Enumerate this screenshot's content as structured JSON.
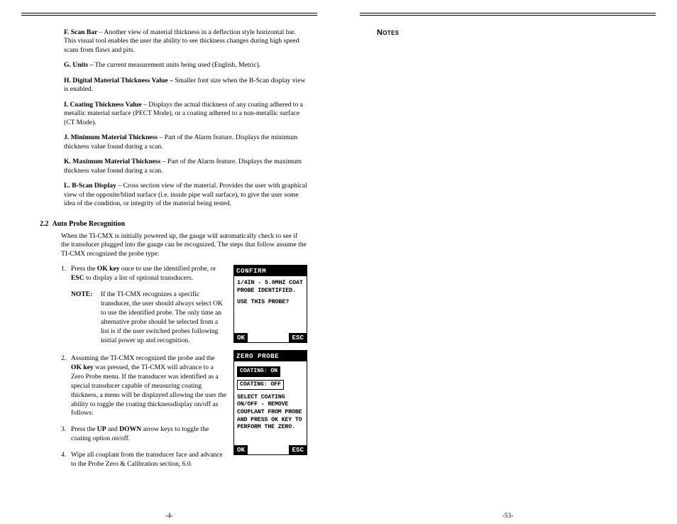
{
  "left": {
    "pageNum": "-4-",
    "defs": [
      {
        "lead": "F.  Scan Bar",
        "sep": " – ",
        "body": "Another view of material thickness in a deflection style horizontal bar. This visual tool enables the user the ability to see thickness changes during high speed scans from flaws and pits."
      },
      {
        "lead": "G. Units –",
        "sep": " ",
        "body": "The current measurement units being used (English, Metric)."
      },
      {
        "lead": "H. Digital Material Thickness Value –",
        "sep": " ",
        "body": "Smaller font size when the B-Scan display view is enabled."
      },
      {
        "lead": "I.  Coating Thickness Value",
        "sep": " – ",
        "body": "Displays the actual thickness of any coating adhered to a metallic material surface (PECT Mode), or a coating adhered to a non-metallic surface (CT Mode)."
      },
      {
        "lead": "J.  Minimum Material Thickness",
        "sep": " – ",
        "body": "Part of the Alarm feature. Displays the minimum thickness value found during a scan."
      },
      {
        "lead": "K. Maximum Material Thickness",
        "sep": " – ",
        "body": "Part of the Alarm feature. Displays the maximum thickness value found during a scan."
      },
      {
        "lead": "L. B-Scan Display",
        "sep": " – ",
        "body": "Cross section view of the material. Provides the user with graphical view of the opposite/blind surface (i.e. inside pipe wall surface), to give the user some idea of the condition, or integrity of the material being tested."
      }
    ],
    "section": {
      "num": "2.2",
      "title": "Auto Probe Recognition",
      "intro": "When the TI-CMX is initially powered up, the gauge will automatically check to see if the transducer plugged into the gauge can be recognized. The steps that follow assume the TI-CMX recognized the probe type:"
    },
    "steps": {
      "s1a": "Press the ",
      "s1key1": "OK key",
      "s1b": " once to use the identified probe, or ",
      "s1key2": "ESC",
      "s1c": " to display a list of optional transducers.",
      "noteLabel": "NOTE:",
      "note": "If the TI-CMX recognizes a specific transducer, the user should always select OK to use the identified probe. The only time an alternative probe should be selected from a list is if the user switched probes following initial power up and recognition.",
      "s2a": "Assuming the TI-CMX recognized the probe and the ",
      "s2key": "OK key",
      "s2b": " was pressed, the TI-CMX will advance to a  Zero Probe menu. If the transducer was identified as a special transducer capable of measuring coating thickness, a menu will be displayed allowing the user the ability to toggle the coating thicknessdisplay on/off as follows:",
      "s3a": "Press the ",
      "s3k1": "UP",
      "s3b": " and ",
      "s3k2": "DOWN",
      "s3c": " arrow keys to toggle the coating option on/off.",
      "s4": "Wipe all couplant from the transducer face and advance to the Probe Zero & Calibration section, 6.0."
    },
    "dev1": {
      "title": "CONFIRM",
      "line1": "1/4IN - 5.0MHZ COAT",
      "line2": "PROBE IDENTIFIED.",
      "line3": "USE THIS PROBE?",
      "ok": "OK",
      "esc": "ESC"
    },
    "dev2": {
      "title": "ZERO PROBE",
      "opt1": "COATING:  ON",
      "opt2": "COATING:  OFF",
      "txt": "SELECT COATING ON/OFF - REMOVE COUPLANT FROM PROBE AND PRESS OK KEY TO PERFORM THE ZERO.",
      "ok": "OK",
      "esc": "ESC"
    }
  },
  "right": {
    "pageNum": "-53-",
    "notesHeading": "Notes"
  }
}
